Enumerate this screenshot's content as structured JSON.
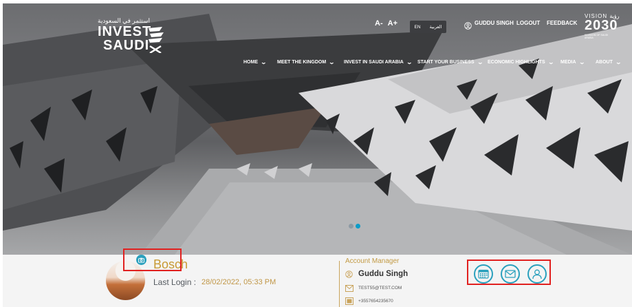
{
  "header": {
    "logo": {
      "arabic": "استثمر في السعودية",
      "line1": "INVEST",
      "line2": "SAUDI"
    },
    "font_controls": {
      "decrease": "A-",
      "increase": "A+"
    },
    "language": {
      "english": "EN",
      "arabic": "العربية"
    },
    "user_name": "GUDDU SINGH",
    "logout": "LOGOUT",
    "feedback": "FEEDBACK",
    "vision": {
      "top": "VISION رؤية",
      "year": "2030",
      "subtitle": "KINGDOM OF SAUDI ARABIA"
    }
  },
  "nav": {
    "items": [
      {
        "label": "HOME"
      },
      {
        "label": "MEET THE KINGDOM"
      },
      {
        "label": "INVEST IN SAUDI ARABIA"
      },
      {
        "label": "START YOUR BUSINESS"
      },
      {
        "label": "ECONOMIC HIGHLIGHTS"
      },
      {
        "label": "MEDIA"
      },
      {
        "label": "ABOUT"
      }
    ],
    "chevron": "⌄"
  },
  "carousel": {
    "slides": 2,
    "active": 2
  },
  "profile": {
    "company": "Bosch",
    "last_login_label": "Last Login :",
    "last_login_value": "28/02/2022, 05:33 PM"
  },
  "account_manager": {
    "title": "Account Manager",
    "name": "Guddu Singh",
    "email": "TEST55@TEST.COM",
    "phone": "+3557654235670"
  },
  "actions": [
    "calendar-icon",
    "mail-icon",
    "user-icon"
  ],
  "colors": {
    "gold": "#c89a34",
    "teal": "#2aa0bd",
    "highlight": "#e1201f",
    "panel": "#f4f4f4"
  }
}
